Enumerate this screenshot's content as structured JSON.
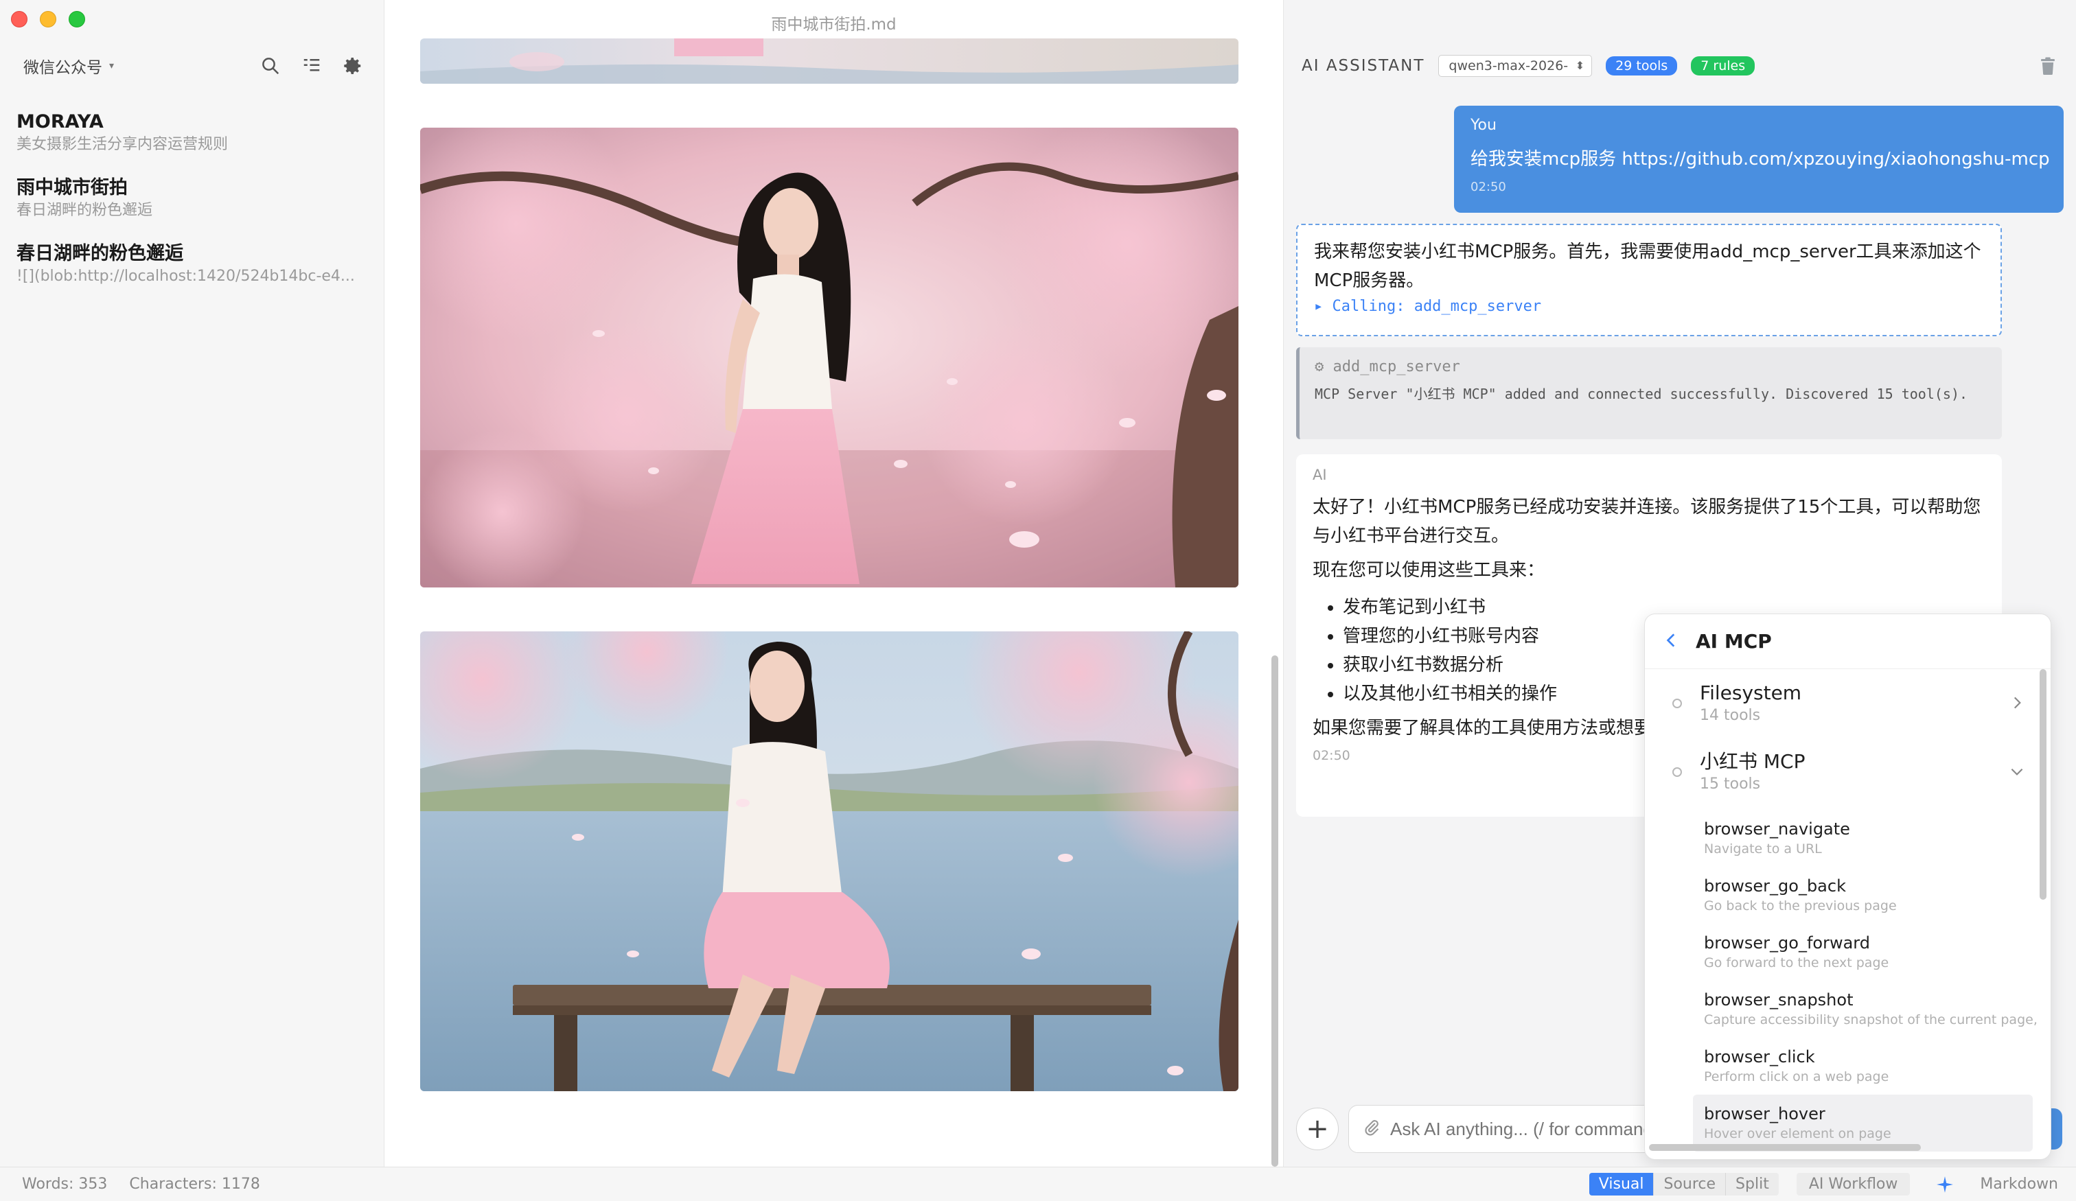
{
  "sidebar": {
    "account": "微信公众号",
    "items": [
      {
        "title": "MORAYA",
        "subtitle": "美女摄影生活分享内容运营规则"
      },
      {
        "title": "雨中城市街拍",
        "subtitle": "春日湖畔的粉色邂逅"
      },
      {
        "title": "春日湖畔的粉色邂逅",
        "subtitle": "![](blob:http://localhost:1420/524b14bc-e4..."
      }
    ]
  },
  "editor": {
    "doc_title": "雨中城市街拍.md"
  },
  "assistant": {
    "title": "AI ASSISTANT",
    "model": "qwen3-max-2026-",
    "tools_badge": "29 tools",
    "rules_badge": "7 rules",
    "user_msg": {
      "who": "You",
      "text": "给我安装mcp服务 https://github.com/xpzouying/xiaohongshu-mcp",
      "time": "02:50"
    },
    "call_msg": {
      "text": "我来帮您安装小红书MCP服务。首先，我需要使用add_mcp_server工具来添加这个MCP服务器。",
      "calling": "▸ Calling: add_mcp_server"
    },
    "tool_msg": {
      "name": "⚙ add_mcp_server",
      "output": "MCP Server \"小红书 MCP\" added and connected successfully. Discovered 15 tool(s)."
    },
    "ai_msg": {
      "who": "AI",
      "p1": "太好了！小红书MCP服务已经成功安装并连接。该服务提供了15个工具，可以帮助您与小红书平台进行交互。",
      "p2": "现在您可以使用这些工具来：",
      "bullets": [
        "发布笔记到小红书",
        "管理您的小红书账号内容",
        "获取小红书数据分析",
        "以及其他小红书相关的操作"
      ],
      "p3": "如果您需要了解具体的工具使用方法或想要做什么，我可以帮您选择合适的工具并",
      "time": "02:50"
    },
    "input_placeholder": "Ask AI anything... (/ for commands)"
  },
  "mcp_panel": {
    "title": "AI MCP",
    "servers": [
      {
        "name": "Filesystem",
        "count": "14 tools",
        "expanded": false
      },
      {
        "name": "小红书 MCP",
        "count": "15 tools",
        "expanded": true
      }
    ],
    "tools": [
      {
        "name": "browser_navigate",
        "desc": "Navigate to a URL"
      },
      {
        "name": "browser_go_back",
        "desc": "Go back to the previous page"
      },
      {
        "name": "browser_go_forward",
        "desc": "Go forward to the next page"
      },
      {
        "name": "browser_snapshot",
        "desc": "Capture accessibility snapshot of the current page,"
      },
      {
        "name": "browser_click",
        "desc": "Perform click on a web page"
      },
      {
        "name": "browser_hover",
        "desc": "Hover over element on page"
      }
    ]
  },
  "statusbar": {
    "words": "Words: 353",
    "characters": "Characters: 1178",
    "modes": [
      "Visual",
      "Source",
      "Split"
    ],
    "active_mode": "Visual",
    "workflow": "AI Workflow",
    "format": "Markdown"
  },
  "colors": {
    "accent": "#3b82f6",
    "user_bubble": "#4a8fe0",
    "rules_badge": "#22c55e"
  }
}
